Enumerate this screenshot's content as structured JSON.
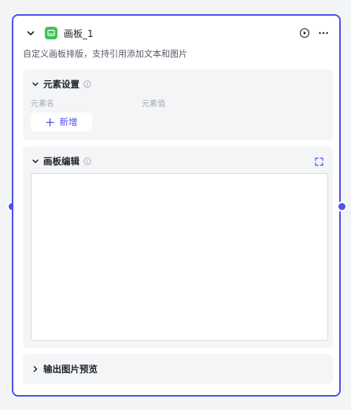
{
  "node": {
    "title": "画板_1",
    "description": "自定义画板排版，支持引用添加文本和图片",
    "icon": "canvas-board-icon",
    "icon_color": "#3ec254",
    "accent_color": "#4d53e8"
  },
  "elements_panel": {
    "title": "元素设置",
    "col_name": "元素名",
    "col_value": "元素值",
    "add_label": "新增"
  },
  "editor_panel": {
    "title": "画板编辑"
  },
  "output_panel": {
    "title": "输出图片预览"
  }
}
